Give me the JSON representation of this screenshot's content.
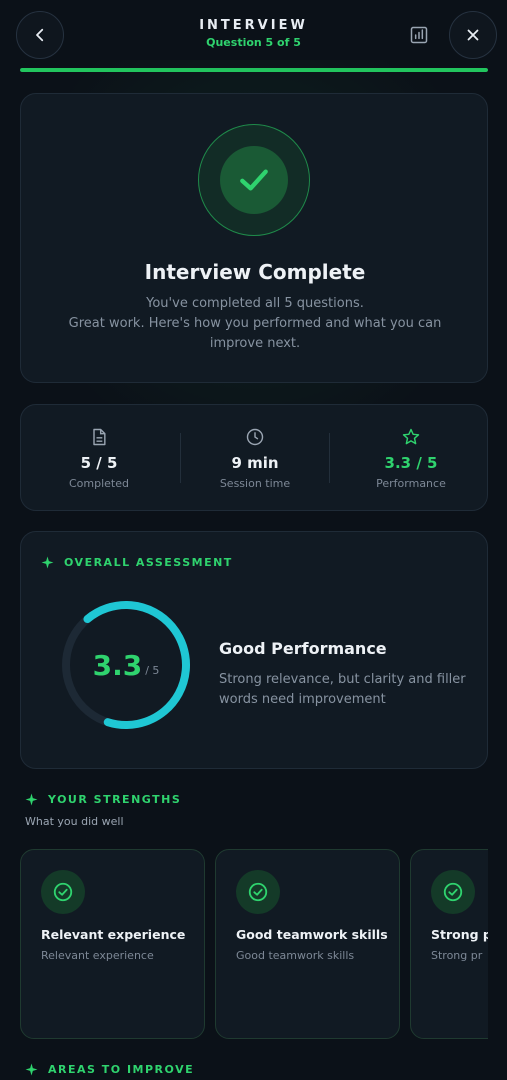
{
  "header": {
    "title": "INTERVIEW",
    "subtitle": "Question 5 of 5",
    "progress": 1.0
  },
  "hero": {
    "title": "Interview Complete",
    "line1": "You've completed all 5 questions.",
    "line2": "Great work. Here's how you performed and what you can",
    "line3": "improve next."
  },
  "stats": [
    {
      "icon": "document-icon",
      "value": "5 / 5",
      "label": "Completed"
    },
    {
      "icon": "clock-icon",
      "value": "9 min",
      "label": "Session time"
    },
    {
      "icon": "star-icon",
      "value": "3.3 / 5",
      "label": "Performance"
    }
  ],
  "assessment": {
    "heading": "OVERALL ASSESSMENT",
    "score": "3.3",
    "score_max": "/ 5",
    "score_fraction": 0.66,
    "title": "Good Performance",
    "description": "Strong relevance, but clarity and filler words need improvement"
  },
  "strengths": {
    "heading": "YOUR STRENGTHS",
    "subheading": "What you did well",
    "items": [
      {
        "title": "Relevant experience",
        "desc": "Relevant experience"
      },
      {
        "title": "Good teamwork skills",
        "desc": "Good teamwork skills"
      },
      {
        "title": "Strong pr",
        "desc": "Strong pr"
      }
    ]
  },
  "improve": {
    "heading": "AREAS TO IMPROVE"
  },
  "colors": {
    "accent_green": "#2fd36e",
    "gauge_cyan": "#1fc7d4",
    "background": "#0b1118",
    "card": "#111a23"
  }
}
